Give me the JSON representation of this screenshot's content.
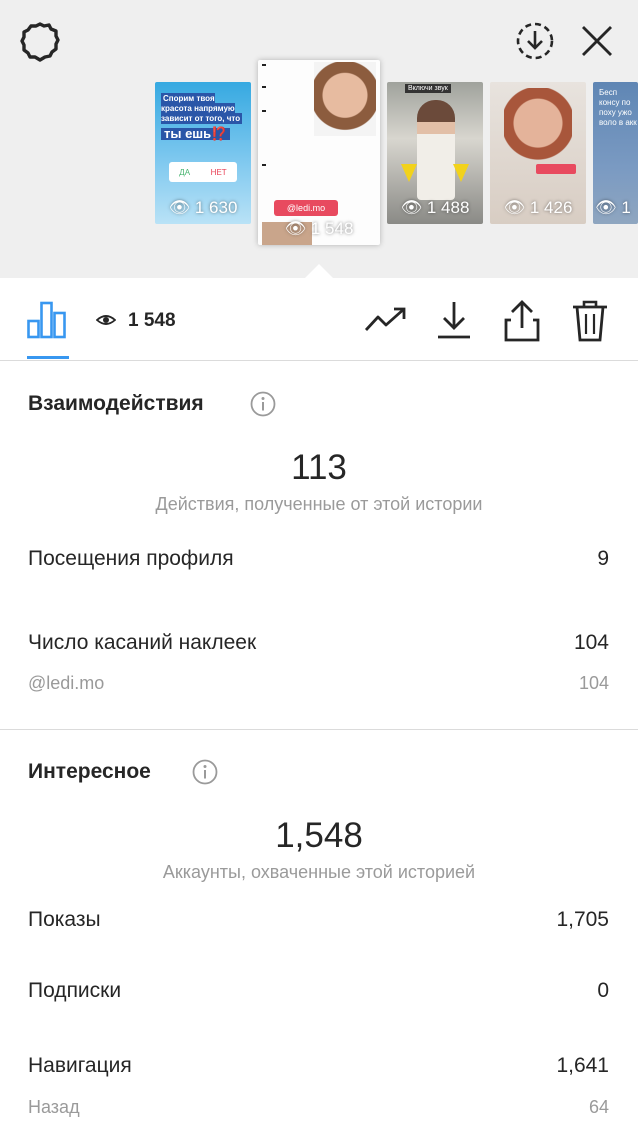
{
  "header": {
    "icons": [
      "gear-icon",
      "download-circle-icon",
      "close-icon"
    ]
  },
  "stories": [
    {
      "views": "1 630"
    },
    {
      "views": "1 548"
    },
    {
      "views": "1 488"
    },
    {
      "views": "1 426"
    },
    {
      "views": "1"
    }
  ],
  "story_texts": {
    "s1_question": "Спорим твоя красота напрямую зависит от того, что",
    "s1_big": "ты ешь⁉️",
    "s1_poll_yes": "ДА",
    "s1_poll_no": "НЕТ",
    "s2_mention": "@ledi.mo",
    "s3_label": "Включи звук",
    "s5_text": "Бесп консу по поху ужо воло в акк"
  },
  "toolbar": {
    "view_count": "1 548",
    "icons": [
      "bar-chart-icon",
      "eye-icon",
      "trending-icon",
      "download-icon",
      "share-icon",
      "trash-icon"
    ]
  },
  "interactions": {
    "title": "Взаимодействия",
    "total": "113",
    "caption": "Действия, полученные от этой истории",
    "profile_visits_label": "Посещения профиля",
    "profile_visits_value": "9",
    "sticker_taps_label": "Число касаний наклеек",
    "sticker_taps_value": "104",
    "sticker_name": "@ledi.mo",
    "sticker_value": "104"
  },
  "discovery": {
    "title": "Интересное",
    "total": "1,548",
    "caption": "Аккаунты, охваченные этой историей",
    "impressions_label": "Показы",
    "impressions_value": "1,705",
    "follows_label": "Подписки",
    "follows_value": "0",
    "navigation_label": "Навигация",
    "navigation_value": "1,641",
    "back_label": "Назад",
    "back_value": "64"
  },
  "colors": {
    "accent": "#3897f0",
    "text": "#262626",
    "secondary": "#9a9a9a",
    "divider": "#dbdbdb",
    "top_bg": "#efefef"
  }
}
